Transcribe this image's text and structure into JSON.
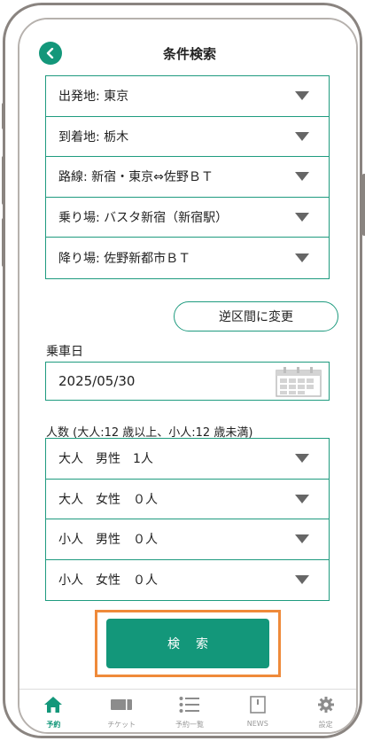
{
  "header": {
    "title": "条件検索"
  },
  "route_selects": [
    {
      "label": "出発地: 東京"
    },
    {
      "label": "到着地: 栃木"
    },
    {
      "label": "路線: 新宿・東京⇔佐野ＢＴ"
    },
    {
      "label": "乗り場: バスタ新宿（新宿駅）"
    },
    {
      "label": "降り場: 佐野新都市ＢＴ"
    }
  ],
  "reverse_button": {
    "label": "逆区間に変更"
  },
  "date": {
    "label": "乗車日",
    "value": "2025/05/30"
  },
  "passengers": {
    "label": "人数 (大人:12 歳以上、小人:12 歳未満)",
    "rows": [
      {
        "label": "大人　男性　1人"
      },
      {
        "label": "大人　女性　０人"
      },
      {
        "label": "小人　男性　０人"
      },
      {
        "label": "小人　女性　０人"
      }
    ]
  },
  "search_button": {
    "label": "検索"
  },
  "tabbar": {
    "items": [
      {
        "label": "予約",
        "icon": "home-icon",
        "active": true
      },
      {
        "label": "チケット",
        "icon": "ticket-icon",
        "active": false
      },
      {
        "label": "予約一覧",
        "icon": "list-icon",
        "active": false
      },
      {
        "label": "NEWS",
        "icon": "news-icon",
        "active": false
      },
      {
        "label": "設定",
        "icon": "gear-icon",
        "active": false
      }
    ]
  },
  "colors": {
    "accent": "#13977a",
    "border": "#1f9b7f",
    "highlight": "#ef8a3a",
    "inactive": "#999999"
  }
}
